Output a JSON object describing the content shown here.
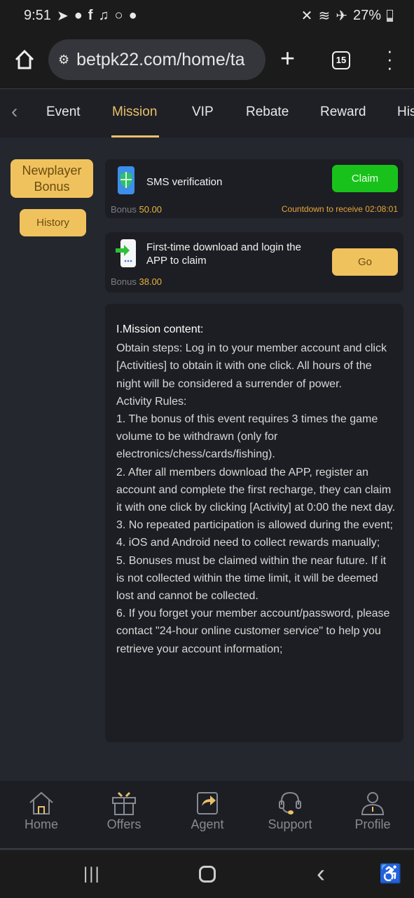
{
  "status_bar": {
    "time": "9:51",
    "battery": "27%",
    "icons": [
      "telegram-icon",
      "messenger-icon",
      "facebook-icon",
      "bell-icon",
      "circle-icon",
      "messenger-icon",
      "mute-icon",
      "wifi-icon",
      "airplane-icon",
      "battery-icon"
    ]
  },
  "browser": {
    "url": "betpk22.com/home/ta",
    "tab_count": "15"
  },
  "tabs": [
    {
      "label": "Event"
    },
    {
      "label": "Mission"
    },
    {
      "label": "VIP"
    },
    {
      "label": "Rebate"
    },
    {
      "label": "Reward"
    },
    {
      "label": "His"
    }
  ],
  "active_tab": "Mission",
  "side": {
    "newplayer_line1": "Newplayer",
    "newplayer_line2": "Bonus",
    "history": "History"
  },
  "missions": [
    {
      "title": "SMS verification",
      "bonus_label": "Bonus",
      "bonus": "50.00",
      "countdown": "Countdown to receive 02:08:01",
      "button": "Claim",
      "button_color": "#19c21b"
    },
    {
      "title": "First-time download and login the APP to claim",
      "bonus_label": "Bonus",
      "bonus": "38.00",
      "button": "Go",
      "button_color": "#f0c25e"
    }
  ],
  "content": {
    "heading": "I.Mission content:",
    "paragraphs": [
      "Obtain steps: Log in to your member account and click [Activities] to obtain it with one click. All hours of the night will be considered a surrender of power.",
      "Activity Rules:",
      "1. The bonus of this event requires 3 times the game volume to be withdrawn (only for electronics/chess/cards/fishing).",
      "2. After all members download the APP, register an account and complete the first recharge, they can claim it with one click by clicking [Activity] at 0:00 the next day.",
      "3. No repeated participation is allowed during the event;",
      "4. iOS and Android need to collect rewards manually;",
      "5. Bonuses must be claimed within the near future. If it is not collected within the time limit, it will be deemed lost and cannot be collected.",
      "6. If you forget your member account/password, please contact \"24-hour online customer service\" to help you retrieve your account information;"
    ]
  },
  "bottom_nav": [
    {
      "label": "Home"
    },
    {
      "label": "Offers"
    },
    {
      "label": "Agent"
    },
    {
      "label": "Support"
    },
    {
      "label": "Profile"
    }
  ],
  "colors": {
    "accent": "#e9c06a",
    "claim": "#19c21b",
    "bonus": "#e9b23f"
  }
}
